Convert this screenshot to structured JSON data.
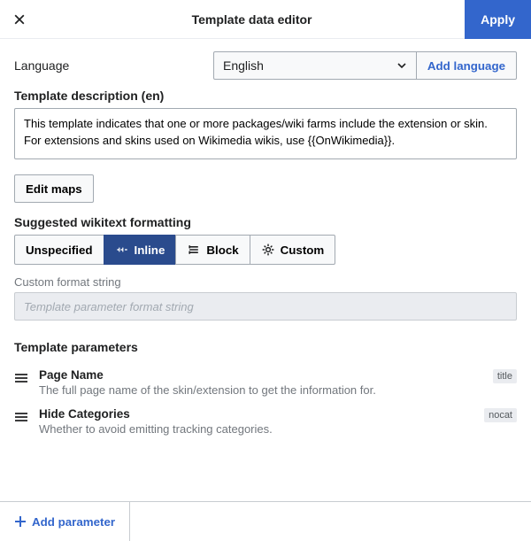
{
  "header": {
    "title": "Template data editor",
    "apply": "Apply"
  },
  "language": {
    "label": "Language",
    "value": "English",
    "add": "Add language"
  },
  "description": {
    "label": "Template description (en)",
    "value": "This template indicates that one or more packages/wiki farms include the extension or skin. For extensions and skins used on Wikimedia wikis, use {{OnWikimedia}}."
  },
  "editMaps": "Edit maps",
  "formatting": {
    "label": "Suggested wikitext formatting",
    "options": {
      "unspecified": "Unspecified",
      "inline": "Inline",
      "block": "Block",
      "custom": "Custom"
    },
    "customLabel": "Custom format string",
    "customPlaceholder": "Template parameter format string"
  },
  "parameters": {
    "label": "Template parameters",
    "items": [
      {
        "name": "Page Name",
        "desc": "The full page name of the skin/extension to get the information for.",
        "badge": "title"
      },
      {
        "name": "Hide Categories",
        "desc": "Whether to avoid emitting tracking categories.",
        "badge": "nocat"
      }
    ]
  },
  "footer": {
    "addParameter": "Add parameter"
  }
}
